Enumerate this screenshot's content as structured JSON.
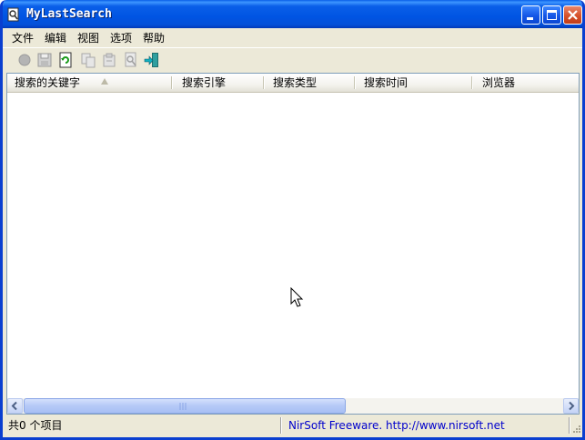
{
  "window": {
    "title": "MyLastSearch"
  },
  "menu": {
    "items": [
      "文件",
      "编辑",
      "视图",
      "选项",
      "帮助"
    ]
  },
  "toolbar": {
    "buttons": [
      {
        "icon": "record-icon",
        "enabled": false
      },
      {
        "icon": "save-icon",
        "enabled": false
      },
      {
        "icon": "refresh-icon",
        "enabled": true
      },
      {
        "icon": "copy-icon",
        "enabled": false
      },
      {
        "icon": "properties-icon",
        "enabled": false
      },
      {
        "icon": "find-icon",
        "enabled": false
      },
      {
        "icon": "exit-icon",
        "enabled": true
      }
    ]
  },
  "list": {
    "columns": [
      "搜索的关键字",
      "搜索引擎",
      "搜索类型",
      "搜索时间",
      "浏览器"
    ],
    "sort_column": "搜索的关键字",
    "sort_direction": "ascending",
    "rows": []
  },
  "status": {
    "count_text": "共0 个项目",
    "credit_text": "NirSoft Freeware.  http://www.nirsoft.net"
  },
  "colors": {
    "titlebar": "#0054e3",
    "window_frame": "#0a3fd0",
    "face": "#ece9d8",
    "credit_link": "#0000cc",
    "close_button": "#d6512a"
  }
}
